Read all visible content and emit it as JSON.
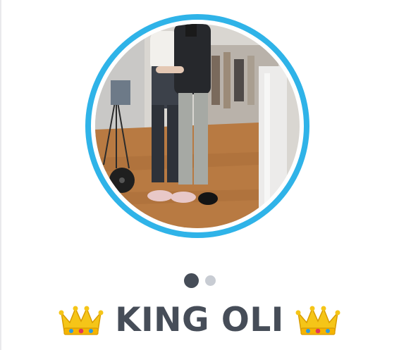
{
  "profile": {
    "name": "KING OLI",
    "photo_description": "",
    "ring_color": "#2fb3e8",
    "name_color": "#464d58"
  },
  "pager": {
    "pages": 2,
    "current": 1,
    "active_color": "#464d58",
    "inactive_color": "#c8ccd3"
  },
  "icons": {
    "left": "crown-icon",
    "right": "crown-icon"
  }
}
